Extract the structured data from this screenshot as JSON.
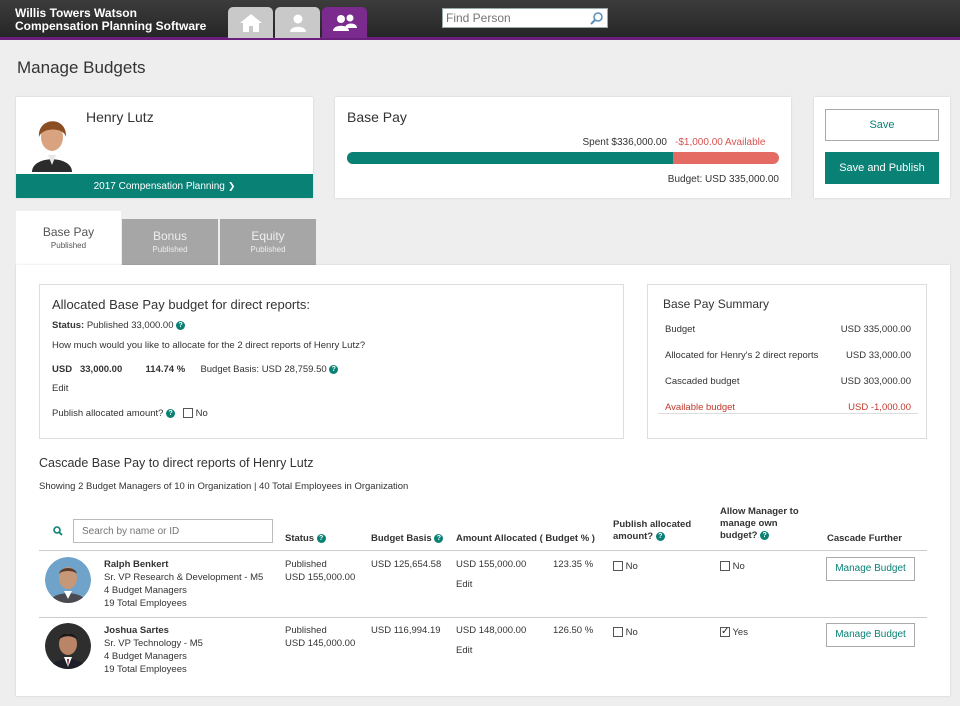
{
  "app": {
    "brand_line1": "Willis Towers Watson",
    "brand_line2": "Compensation Planning Software",
    "find_placeholder": "Find Person"
  },
  "page_title": "Manage Budgets",
  "profile": {
    "name": "Henry Lutz",
    "plan": "2017 Compensation Planning"
  },
  "base_pay_card": {
    "title": "Base Pay",
    "spent": "Spent $336,000.00",
    "available": "-$1,000.00 Available",
    "budget": "Budget: USD 335,000.00",
    "spent_fraction": 0.755
  },
  "actions": {
    "save": "Save",
    "save_publish": "Save and Publish"
  },
  "tabs": [
    {
      "label": "Base Pay",
      "status": "Published"
    },
    {
      "label": "Bonus",
      "status": "Published"
    },
    {
      "label": "Equity",
      "status": "Published"
    }
  ],
  "alloc": {
    "heading": "Allocated Base Pay budget for direct reports:",
    "status_label": "Status:",
    "status_value": "Published 33,000.00",
    "question": "How much would you like to allocate for the 2 direct reports of Henry Lutz?",
    "currency": "USD",
    "amount": "33,000.00",
    "percent": "114.74 %",
    "budget_basis": "Budget Basis: USD 28,759.50",
    "edit": "Edit",
    "publish_label": "Publish allocated amount?",
    "publish_value": "No"
  },
  "summary": {
    "heading": "Base Pay Summary",
    "rows": [
      {
        "label": "Budget",
        "value": "USD 335,000.00"
      },
      {
        "label": "Allocated for Henry's 2 direct reports",
        "value": "USD 33,000.00"
      },
      {
        "label": "Cascaded budget",
        "value": "USD 303,000.00"
      },
      {
        "label": "Available budget",
        "value": "USD -1,000.00"
      }
    ]
  },
  "cascade": {
    "heading": "Cascade Base Pay to direct reports of Henry Lutz",
    "showing": "Showing 2 Budget Managers of 10 in Organization | 40 Total Employees in Organization",
    "search_placeholder": "Search by name or ID",
    "columns": {
      "status": "Status",
      "budget_basis": "Budget Basis",
      "amount_allocated": "Amount Allocated ( Budget % )",
      "publish_line1": "Publish allocated",
      "publish_line2": "amount?",
      "allow_line1": "Allow Manager to",
      "allow_line2": "manage own",
      "allow_line3": "budget?",
      "cascade_further": "Cascade Further"
    },
    "rows": [
      {
        "name": "Ralph Benkert",
        "title": "Sr. VP Research & Development - M5",
        "managers": "4 Budget Managers",
        "employees": "19 Total Employees",
        "status": "Published",
        "status_amount": "USD 155,000.00",
        "budget_basis": "USD 125,654.58",
        "amount": "USD 155,000.00",
        "pct": "123.35 %",
        "edit": "Edit",
        "publish": "No",
        "allow": "No",
        "allow_checked": false,
        "button": "Manage Budget"
      },
      {
        "name": "Joshua Sartes",
        "title": "Sr. VP Technology - M5",
        "managers": "4 Budget Managers",
        "employees": "19 Total Employees",
        "status": "Published",
        "status_amount": "USD 145,000.00",
        "budget_basis": "USD 116,994.19",
        "amount": "USD 148,000.00",
        "pct": "126.50 %",
        "edit": "Edit",
        "publish": "No",
        "allow": "Yes",
        "allow_checked": true,
        "button": "Manage Budget"
      }
    ]
  },
  "colors": {
    "accent": "#0a8175",
    "brand_purple": "#7b2a8e",
    "negative": "#e46b64"
  }
}
